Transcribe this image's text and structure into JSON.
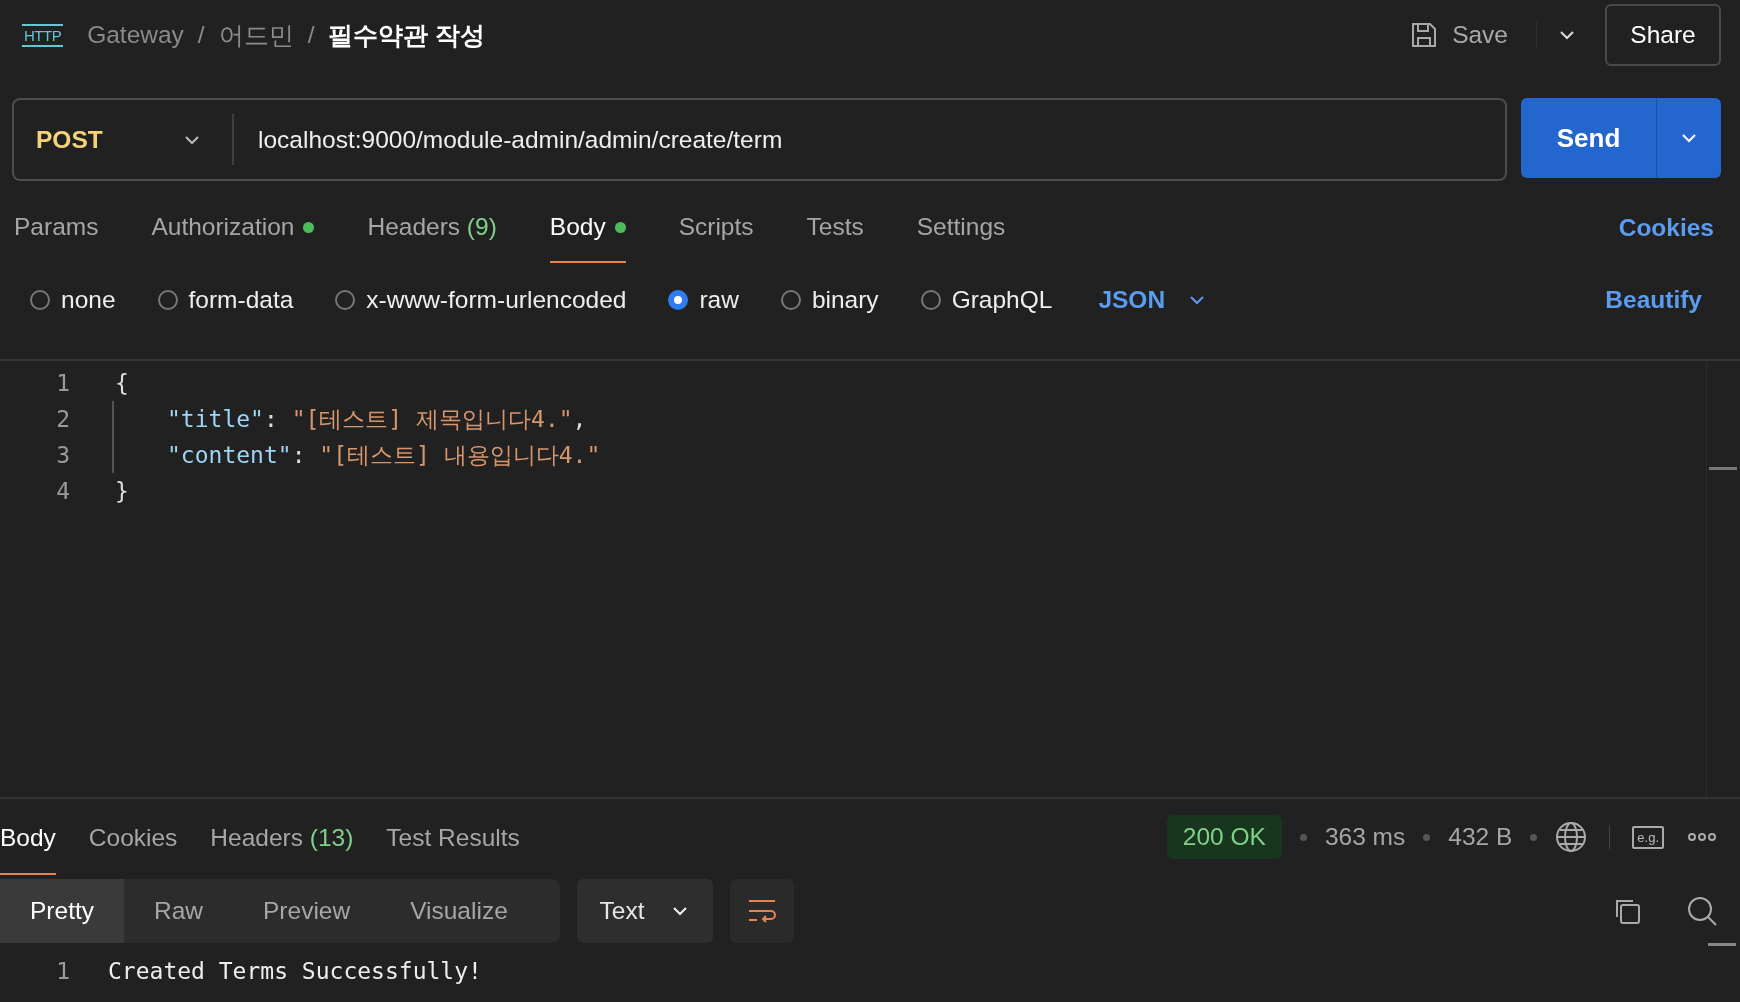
{
  "breadcrumb": {
    "logo": "HTTP",
    "items": [
      "Gateway",
      "어드민",
      "필수약관 작성"
    ],
    "separator": "/"
  },
  "header_actions": {
    "save": "Save",
    "share": "Share"
  },
  "request": {
    "method": "POST",
    "url": "localhost:9000/module-admin/admin/create/term",
    "send": "Send"
  },
  "request_tabs": [
    {
      "label": "Params",
      "selected": false,
      "dot": false
    },
    {
      "label": "Authorization",
      "selected": false,
      "dot": true
    },
    {
      "label": "Headers",
      "count": "(9)",
      "selected": false,
      "dot": false
    },
    {
      "label": "Body",
      "selected": true,
      "dot": true
    },
    {
      "label": "Scripts",
      "selected": false,
      "dot": false
    },
    {
      "label": "Tests",
      "selected": false,
      "dot": false
    },
    {
      "label": "Settings",
      "selected": false,
      "dot": false
    }
  ],
  "cookies_link": "Cookies",
  "body_types": [
    {
      "label": "none",
      "selected": false
    },
    {
      "label": "form-data",
      "selected": false
    },
    {
      "label": "x-www-form-urlencoded",
      "selected": false
    },
    {
      "label": "raw",
      "selected": true
    },
    {
      "label": "binary",
      "selected": false
    },
    {
      "label": "GraphQL",
      "selected": false
    }
  ],
  "raw_format": "JSON",
  "beautify": "Beautify",
  "editor_lines": [
    {
      "number": "1",
      "indented": false,
      "tokens": [
        {
          "kind": "punct",
          "text": "{"
        }
      ]
    },
    {
      "number": "2",
      "indented": true,
      "tokens": [
        {
          "kind": "key",
          "text": "\"title\""
        },
        {
          "kind": "punct",
          "text": ": "
        },
        {
          "kind": "string",
          "text": "\"[테스트] 제목입니다4.\""
        },
        {
          "kind": "punct",
          "text": ","
        }
      ]
    },
    {
      "number": "3",
      "indented": true,
      "tokens": [
        {
          "kind": "key",
          "text": "\"content\""
        },
        {
          "kind": "punct",
          "text": ": "
        },
        {
          "kind": "string",
          "text": "\"[테스트] 내용입니다4.\""
        }
      ]
    },
    {
      "number": "4",
      "indented": false,
      "tokens": [
        {
          "kind": "punct",
          "text": "}"
        }
      ]
    }
  ],
  "response_tabs": [
    {
      "label": "Body",
      "selected": true
    },
    {
      "label": "Cookies",
      "selected": false
    },
    {
      "label": "Headers",
      "count": "(13)",
      "selected": false
    },
    {
      "label": "Test Results",
      "selected": false
    }
  ],
  "response_status": {
    "status": "200 OK",
    "time": "363 ms",
    "size": "432 B",
    "examples": "e.g."
  },
  "response_views": [
    {
      "label": "Pretty",
      "selected": true
    },
    {
      "label": "Raw",
      "selected": false
    },
    {
      "label": "Preview",
      "selected": false
    },
    {
      "label": "Visualize",
      "selected": false
    }
  ],
  "response_format": "Text",
  "response_lines": [
    {
      "number": "1",
      "text": "Created Terms Successfully!"
    }
  ]
}
